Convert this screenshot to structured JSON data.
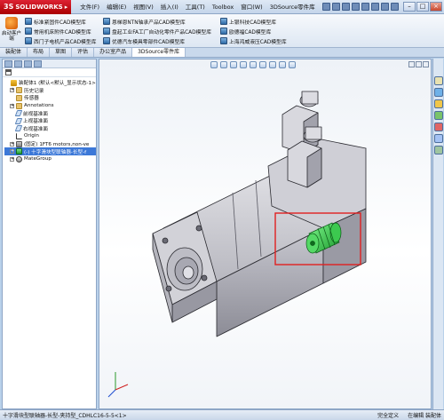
{
  "app": {
    "logo_text": "SOLIDWORKS",
    "menus": [
      "文件(F)",
      "编辑(E)",
      "视图(V)",
      "插入(I)",
      "工具(T)",
      "Toolbox",
      "窗口(W)",
      "3DSource零件库"
    ]
  },
  "ribbon": {
    "start_label": "启动客户端",
    "columns": [
      [
        "标准紧固件CAD模型库",
        "常用机床附件CAD模型库",
        "西门子电机产品CAD模型库"
      ],
      [
        "恩梯恩NTN轴承产品CAD模型库",
        "盘起工业FA工厂自动化零件产品CAD模型库",
        "优德汽车模具零部件CAD模型库"
      ],
      [
        "上银科技CAD模型库",
        "欧德福CAD模型库",
        "上海鸿威液压CAD模型库"
      ]
    ]
  },
  "tabs": [
    "装配体",
    "布局",
    "草图",
    "评估",
    "办公室产品",
    "3DSource零件库"
  ],
  "active_tab": "3DSource零件库",
  "tree": [
    {
      "label": "装配体1 (默认<默认_显示状态-1>)",
      "icon": "assembly-icon",
      "expand": "",
      "sel": false,
      "indent": 0
    },
    {
      "label": "历史记录",
      "icon": "folder-icon",
      "expand": "+",
      "sel": false,
      "indent": 1
    },
    {
      "label": "传感器",
      "icon": "folder-icon",
      "expand": "",
      "sel": false,
      "indent": 1
    },
    {
      "label": "Annotations",
      "icon": "folder-icon",
      "expand": "+",
      "sel": false,
      "indent": 1
    },
    {
      "label": "前视基准面",
      "icon": "plane-icon",
      "expand": "",
      "sel": false,
      "indent": 1
    },
    {
      "label": "上视基准面",
      "icon": "plane-icon",
      "expand": "",
      "sel": false,
      "indent": 1
    },
    {
      "label": "右视基准面",
      "icon": "plane-icon",
      "expand": "",
      "sel": false,
      "indent": 1
    },
    {
      "label": "Origin",
      "icon": "origin-icon",
      "expand": "",
      "sel": false,
      "indent": 1
    },
    {
      "label": "(固定) 1FT6 motors,non-ve",
      "icon": "part-icon",
      "expand": "+",
      "sel": false,
      "indent": 1
    },
    {
      "label": "(-) 十字滑块型联轴器-长型-f",
      "icon": "part-green-icon",
      "expand": "+",
      "sel": true,
      "indent": 1
    },
    {
      "label": "MateGroup",
      "icon": "mate-icon",
      "expand": "+",
      "sel": false,
      "indent": 1
    }
  ],
  "status": {
    "left": "十字滑块型联轴器-长型-夹持型_CDHLC16-5-5<1>",
    "mid": "完全定义",
    "right": "在编辑 装配体"
  },
  "colors": {
    "accent": "#3c78d8",
    "highlight_box": "#e02020",
    "coupling_green": "#2fc13c"
  }
}
